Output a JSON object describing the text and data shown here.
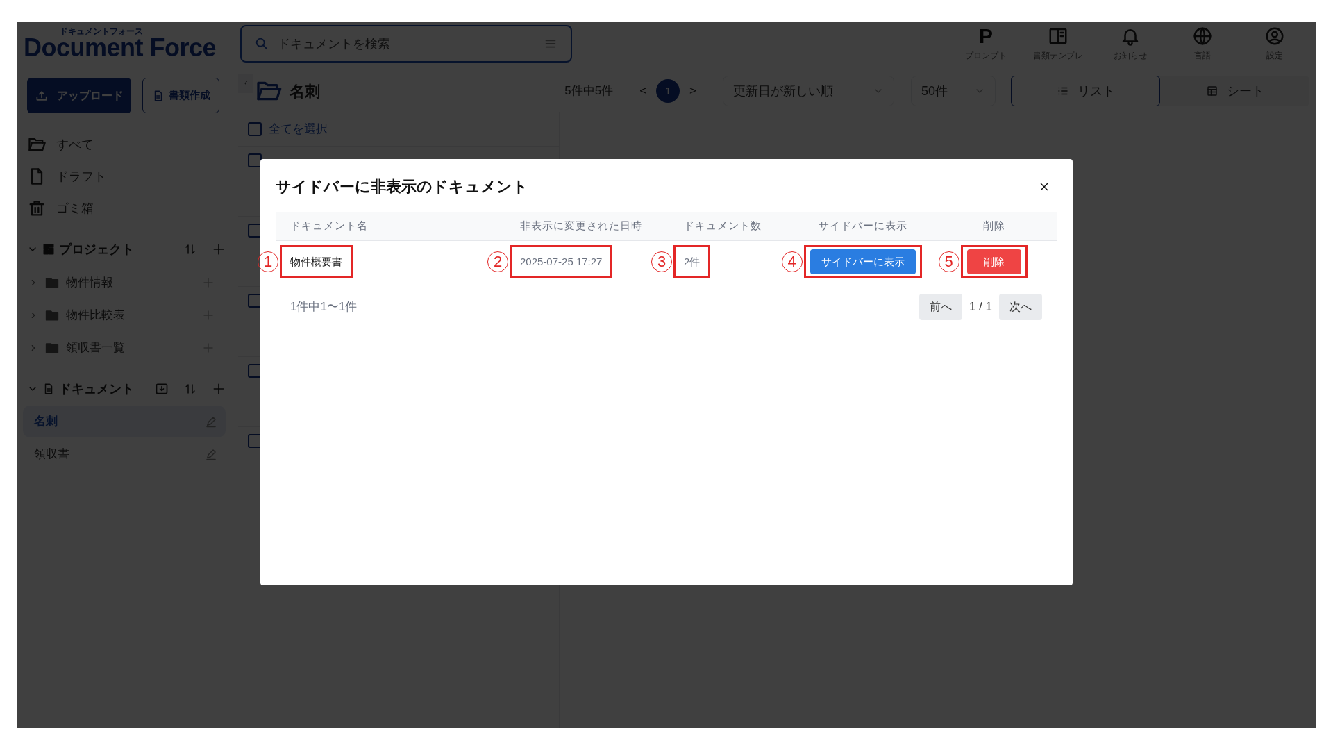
{
  "header": {
    "logo_kana": "ドキュメントフォース",
    "logo": "Document Force",
    "search": {
      "placeholder": "ドキュメントを検索"
    },
    "actions": [
      {
        "kind": "prompt",
        "glyph": "P",
        "label": "プロンプト"
      },
      {
        "kind": "template",
        "label": "書類テンプレ"
      },
      {
        "kind": "bell",
        "label": "お知らせ"
      },
      {
        "kind": "globe",
        "label": "言語"
      },
      {
        "kind": "user",
        "label": "設定"
      }
    ]
  },
  "sidebar": {
    "buttons": [
      {
        "kind": "primary",
        "label": "アップロード"
      },
      {
        "kind": "outline",
        "label": "書類作成"
      }
    ],
    "nav": [
      {
        "kind": "folder",
        "label": "すべて"
      },
      {
        "kind": "file",
        "label": "ドラフト"
      },
      {
        "kind": "trash",
        "label": "ゴミ箱"
      }
    ],
    "sections": [
      {
        "kind": "project",
        "title": "プロジェクト",
        "expanded": true,
        "items": [
          {
            "label": "物件情報",
            "expanded": false
          },
          {
            "label": "物件比較表",
            "expanded": false
          },
          {
            "label": "領収書一覧",
            "expanded": false
          }
        ]
      },
      {
        "kind": "document",
        "title": "ドキュメント",
        "expanded": true,
        "items": [
          {
            "label": "名刺",
            "selected": true
          },
          {
            "label": "領収書",
            "selected": false
          }
        ]
      }
    ]
  },
  "toolbar": {
    "folder": "名刺",
    "count": "5件中5件",
    "prev": "<",
    "next": ">",
    "pages": [
      {
        "label": "1",
        "selected": true
      }
    ],
    "sort": "更新日が新しい順",
    "per_page": "50件",
    "views": [
      {
        "kind": "list",
        "label": "リスト",
        "selected": true
      },
      {
        "kind": "sheet",
        "label": "シート",
        "selected": false
      }
    ]
  },
  "list": {
    "select_all": {
      "label": "全てを選択",
      "checked": false
    },
    "rows": [
      {
        "checked": false
      },
      {
        "checked": false
      },
      {
        "checked": false
      },
      {
        "checked": false
      },
      {
        "checked": false
      }
    ]
  },
  "modal": {
    "title": "サイドバーに非表示のドキュメント",
    "columns": [
      "ドキュメント名",
      "非表示に変更された日時",
      "ドキュメント数",
      "サイドバーに表示",
      "削除"
    ],
    "rows": [
      {
        "cells": [
          {
            "kind": "name",
            "text": "物件概要書",
            "callout": "1"
          },
          {
            "kind": "muted",
            "text": "2025-07-25 17:27",
            "callout": "2"
          },
          {
            "kind": "muted",
            "text": "2件",
            "callout": "3"
          },
          {
            "kind": "primary-button",
            "text": "サイドバーに表示",
            "callout": "4"
          },
          {
            "kind": "danger-button",
            "text": "削除",
            "callout": "5"
          }
        ]
      }
    ],
    "summary": "1件中1〜1件",
    "pager": {
      "prev": "前へ",
      "page": "1 / 1",
      "next": "次へ"
    }
  }
}
